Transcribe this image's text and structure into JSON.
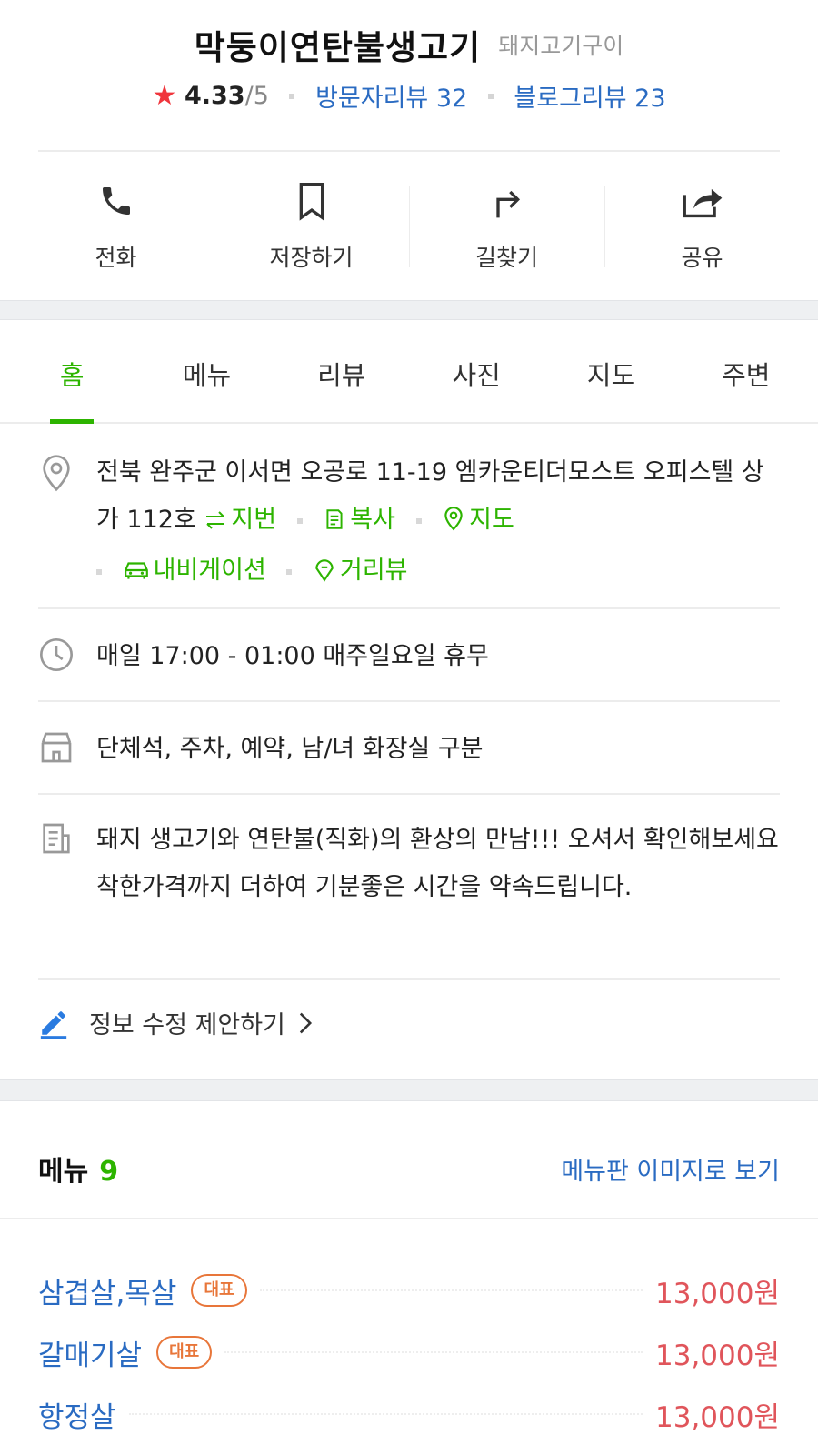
{
  "header": {
    "name": "막둥이연탄불생고기",
    "category": "돼지고기구이",
    "rating": "4.33",
    "rating_max": "/5",
    "visitor_reviews": "방문자리뷰 32",
    "blog_reviews": "블로그리뷰 23"
  },
  "actions": {
    "call": "전화",
    "save": "저장하기",
    "directions": "길찾기",
    "share": "공유"
  },
  "tabs": [
    "홈",
    "메뉴",
    "리뷰",
    "사진",
    "지도",
    "주변"
  ],
  "info": {
    "address": "전북 완주군 이서면 오공로 11-19 엠카운티더모스트 오피스텔 상가 112호",
    "address_links": {
      "lot": "지번",
      "copy": "복사",
      "map": "지도",
      "navigation": "내비게이션",
      "street_view": "거리뷰"
    },
    "hours": "매일 17:00 - 01:00 매주일요일 휴무",
    "facilities": "단체석, 주차, 예약, 남/녀 화장실 구분",
    "description": "돼지 생고기와 연탄불(직화)의 환상의 만남!!! 오셔서 확인해보세요 착한가격까지 더하여 기분좋은 시간을 약속드립니다."
  },
  "edit_suggestion": "정보 수정 제안하기",
  "menu": {
    "title": "메뉴",
    "count": "9",
    "image_link": "메뉴판 이미지로 보기",
    "badge": "대표",
    "items": [
      {
        "name": "삼겹살,목살",
        "price": "13,000원",
        "representative": true
      },
      {
        "name": "갈매기살",
        "price": "13,000원",
        "representative": true
      },
      {
        "name": "항정살",
        "price": "13,000원",
        "representative": false
      }
    ]
  },
  "colors": {
    "green": "#2db400",
    "blue_link": "#2a6bc2",
    "price_red": "#e0555b",
    "badge_orange": "#e8763a",
    "star_red": "#f0353c"
  }
}
